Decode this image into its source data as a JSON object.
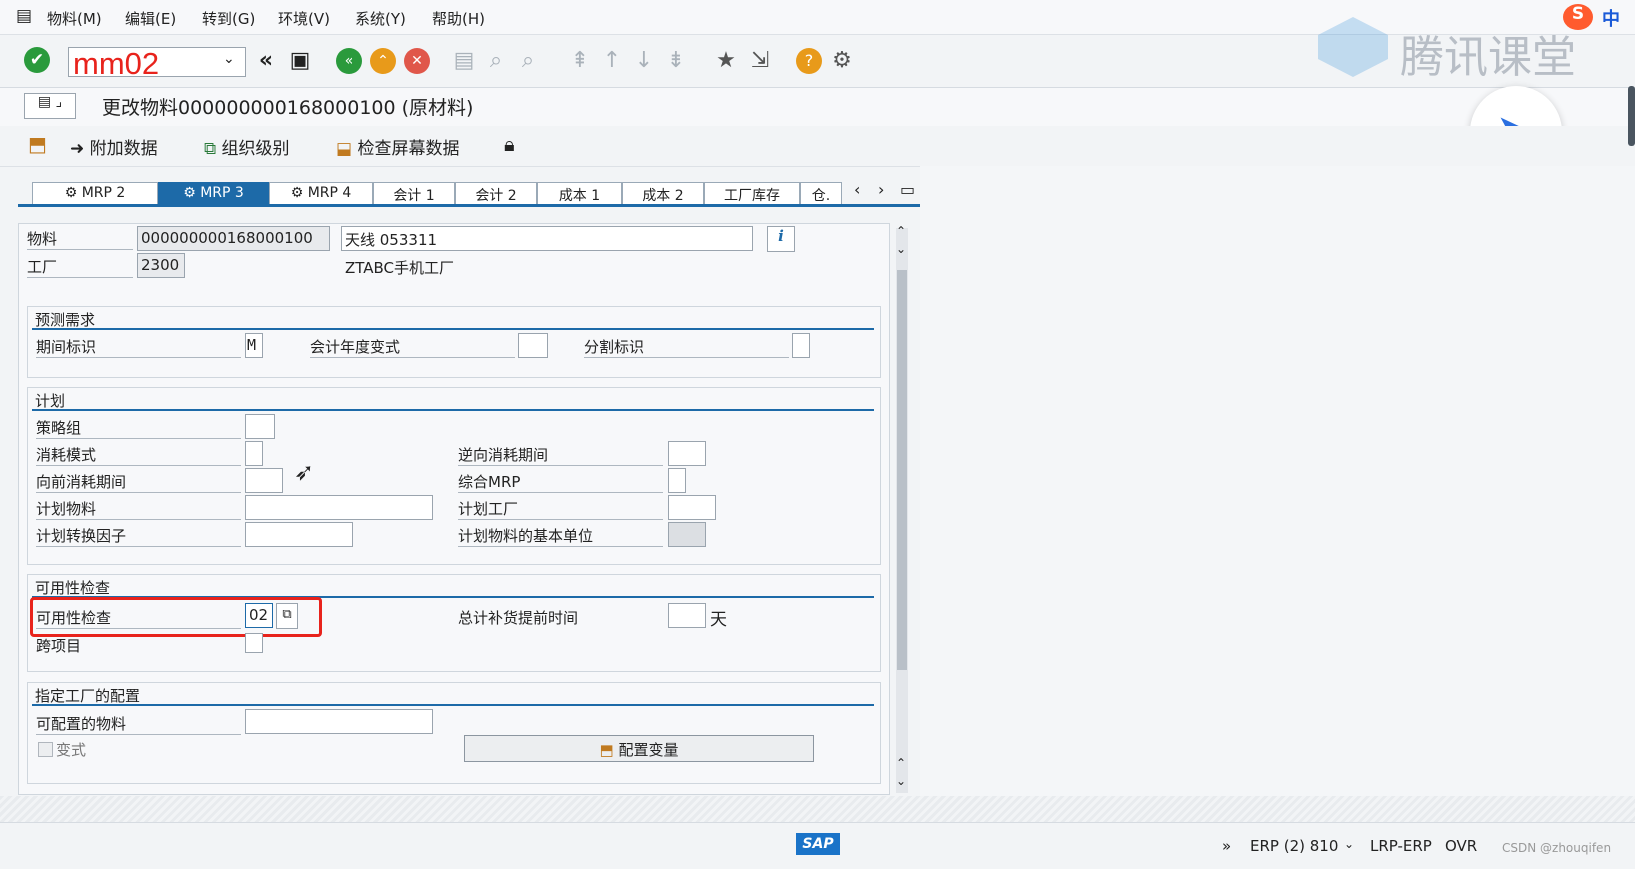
{
  "menu": [
    "物料(M)",
    "编辑(E)",
    "转到(G)",
    "环境(V)",
    "系统(Y)",
    "帮助(H)"
  ],
  "command_field": "mm02",
  "watermark": "腾讯课堂",
  "ime": "中",
  "title": "更改物料000000000168000100 (原材料)",
  "app_toolbar": [
    "附加数据",
    "组织级别",
    "检查屏幕数据"
  ],
  "tabs": [
    "MRP 2",
    "MRP 3",
    "MRP 4",
    "会计 1",
    "会计 2",
    "成本 1",
    "成本 2",
    "工厂库存",
    "仓."
  ],
  "active_tab": "MRP 3",
  "header": {
    "material_label": "物料",
    "material_value": "000000000168000100",
    "material_desc": "天线 053311",
    "plant_label": "工厂",
    "plant_value": "2300",
    "plant_desc": "ZTABC手机工厂"
  },
  "forecast": {
    "title": "预测需求",
    "period_label": "期间标识",
    "period_value": "M",
    "fiscal_label": "会计年度变式",
    "fiscal_value": "",
    "split_label": "分割标识",
    "split_value": ""
  },
  "planning": {
    "title": "计划",
    "strategy_label": "策略组",
    "consump_mode_label": "消耗模式",
    "bwd_label": "逆向消耗期间",
    "fwd_label": "向前消耗期间",
    "mixed_mrp_label": "综合MRP",
    "planning_material_label": "计划物料",
    "planning_plant_label": "计划工厂",
    "conv_factor_label": "计划转换因子",
    "base_unit_label": "计划物料的基本单位"
  },
  "availability": {
    "title": "可用性检查",
    "check_label": "可用性检查",
    "check_value": "02",
    "total_leadtime_label": "总计补货提前时间",
    "total_leadtime_value": "",
    "unit": "天",
    "cross_project_label": "跨项目"
  },
  "plant_config": {
    "title": "指定工厂的配置",
    "configurable_label": "可配置的物料",
    "variant_label": "变式",
    "config_variant_button": "配置变量"
  },
  "status": {
    "system": "ERP (2) 810",
    "server": "LRP-ERP",
    "mode": "OVR",
    "watermark": "CSDN @zhouqifen"
  },
  "colors": {
    "accent": "#1d6aa8",
    "highlight_box": "#e8231c"
  }
}
